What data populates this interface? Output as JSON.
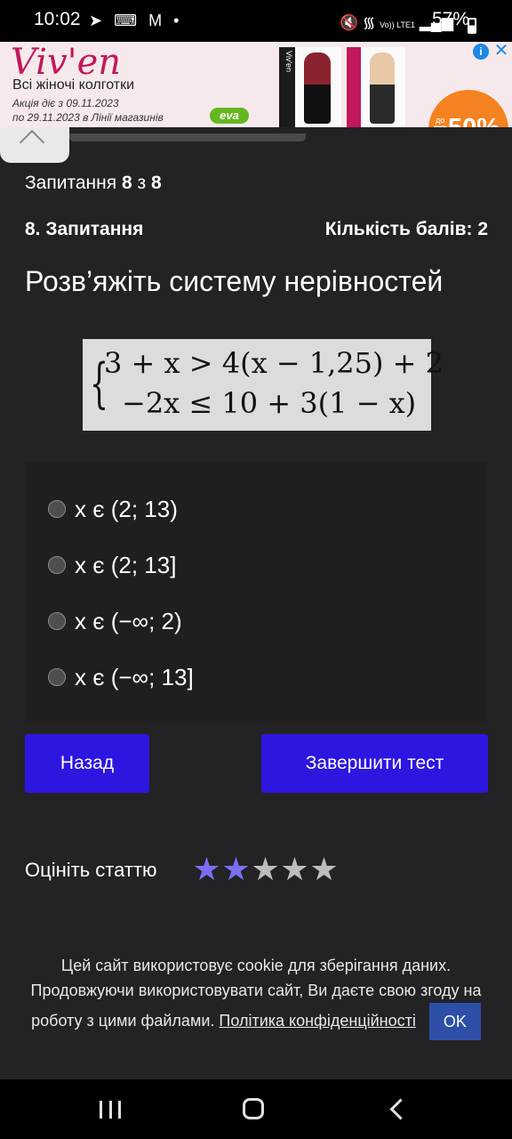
{
  "status_bar": {
    "time": "10:02",
    "left_icons": [
      "telegram-icon",
      "keyboard-icon",
      "gmail-icon",
      "dot-icon"
    ],
    "right_icons": [
      "mute-icon",
      "wifi-icon",
      "volte-icon",
      "signal-icon"
    ],
    "volte_text": "Vo)) LTE1",
    "battery_percent": "57%",
    "battery_level": 0.57
  },
  "ad": {
    "brand": "Viv'en",
    "headline": "Всі жіночі колготки",
    "promo_line1": "Акція діє з 09.11.2023",
    "promo_line2": "по 29.11.2023 в Лінії магазинів",
    "store_logo": "eva",
    "discount_prefix": "до",
    "discount": "−50%",
    "colors": {
      "brand": "#c2185b",
      "discount_bg": "#f58220",
      "eva": "#64b81e"
    }
  },
  "quiz": {
    "progress_prefix": "Запитання",
    "progress_current": "8",
    "progress_sep": "з",
    "progress_total": "8",
    "question_title": "8. Запитання",
    "points": "Кількість балів: 2",
    "question_text": "Розв’яжіть систему нерівностей",
    "formula": {
      "line1": "3 + x > 4(x − 1,25) + 2",
      "line2": "−2x ≤ 10 + 3(1 − x)"
    },
    "options": [
      {
        "label": "x є (2; 13)"
      },
      {
        "label": "x є (2; 13]"
      },
      {
        "label": "x є (−∞; 2)"
      },
      {
        "label": "x є (−∞; 13]"
      }
    ],
    "back_label": "Назад",
    "finish_label": "Завершити тест"
  },
  "rating": {
    "label": "Оцініть статтю",
    "value": 2,
    "max": 5,
    "active_color": "#7b6ef5"
  },
  "cookie": {
    "text": "Цей сайт використовує cookie для зберігання даних. Продовжуючи використовувати сайт, Ви даєте свою згоду на роботу з цими файлами.",
    "policy_link": "Політика конфіденційності",
    "ok_label": "OK"
  },
  "accent_color": "#2d16e0"
}
